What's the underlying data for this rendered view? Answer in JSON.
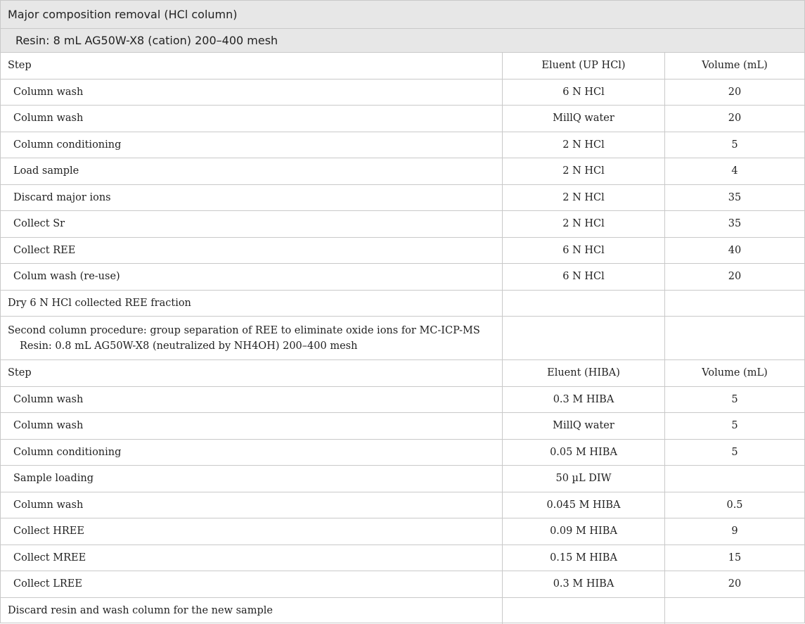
{
  "title": "Major composition removal (HCl column)",
  "resin1": "Resin: 8 mL AG50W-X8 (cation) 200–400 mesh",
  "section1": {
    "headers": [
      "Step",
      "Eluent (UP HCl)",
      "Volume (mL)"
    ],
    "rows": [
      {
        "step": "Column wash",
        "eluent": "6 N HCl",
        "volume": "20"
      },
      {
        "step": "Column wash",
        "eluent": "MillQ water",
        "volume": "20"
      },
      {
        "step": "Column conditioning",
        "eluent": "2 N HCl",
        "volume": "5"
      },
      {
        "step": "Load sample",
        "eluent": "2 N HCl",
        "volume": "4"
      },
      {
        "step": "Discard major ions",
        "eluent": "2 N HCl",
        "volume": "35"
      },
      {
        "step": "Collect Sr",
        "eluent": "2 N HCl",
        "volume": "35"
      },
      {
        "step": "Collect REE",
        "eluent": "6 N HCl",
        "volume": "40"
      },
      {
        "step": "Colum wash (re-use)",
        "eluent": "6 N HCl",
        "volume": "20"
      }
    ],
    "note": "Dry 6 N HCl collected REE fraction"
  },
  "section2": {
    "title": "Second column procedure: group separation of REE to eliminate oxide ions for MC-ICP-MS",
    "resin": "Resin: 0.8 mL AG50W-X8 (neutralized by NH4OH) 200–400 mesh",
    "headers": [
      "Step",
      "Eluent (HIBA)",
      "Volume (mL)"
    ],
    "rows": [
      {
        "step": "Column wash",
        "eluent": "0.3 M HIBA",
        "volume": "5"
      },
      {
        "step": "Column wash",
        "eluent": "MillQ water",
        "volume": "5"
      },
      {
        "step": "Column conditioning",
        "eluent": "0.05 M HIBA",
        "volume": "5"
      },
      {
        "step": "Sample loading",
        "eluent": "50 µL DIW",
        "volume": ""
      },
      {
        "step": "Column wash",
        "eluent": "0.045 M HIBA",
        "volume": "0.5"
      },
      {
        "step": "Collect HREE",
        "eluent": "0.09 M HIBA",
        "volume": "9"
      },
      {
        "step": "Collect MREE",
        "eluent": "0.15 M HIBA",
        "volume": "15"
      },
      {
        "step": "Collect LREE",
        "eluent": "0.3 M HIBA",
        "volume": "20"
      }
    ],
    "note": "Discard resin and wash column for the new sample"
  }
}
